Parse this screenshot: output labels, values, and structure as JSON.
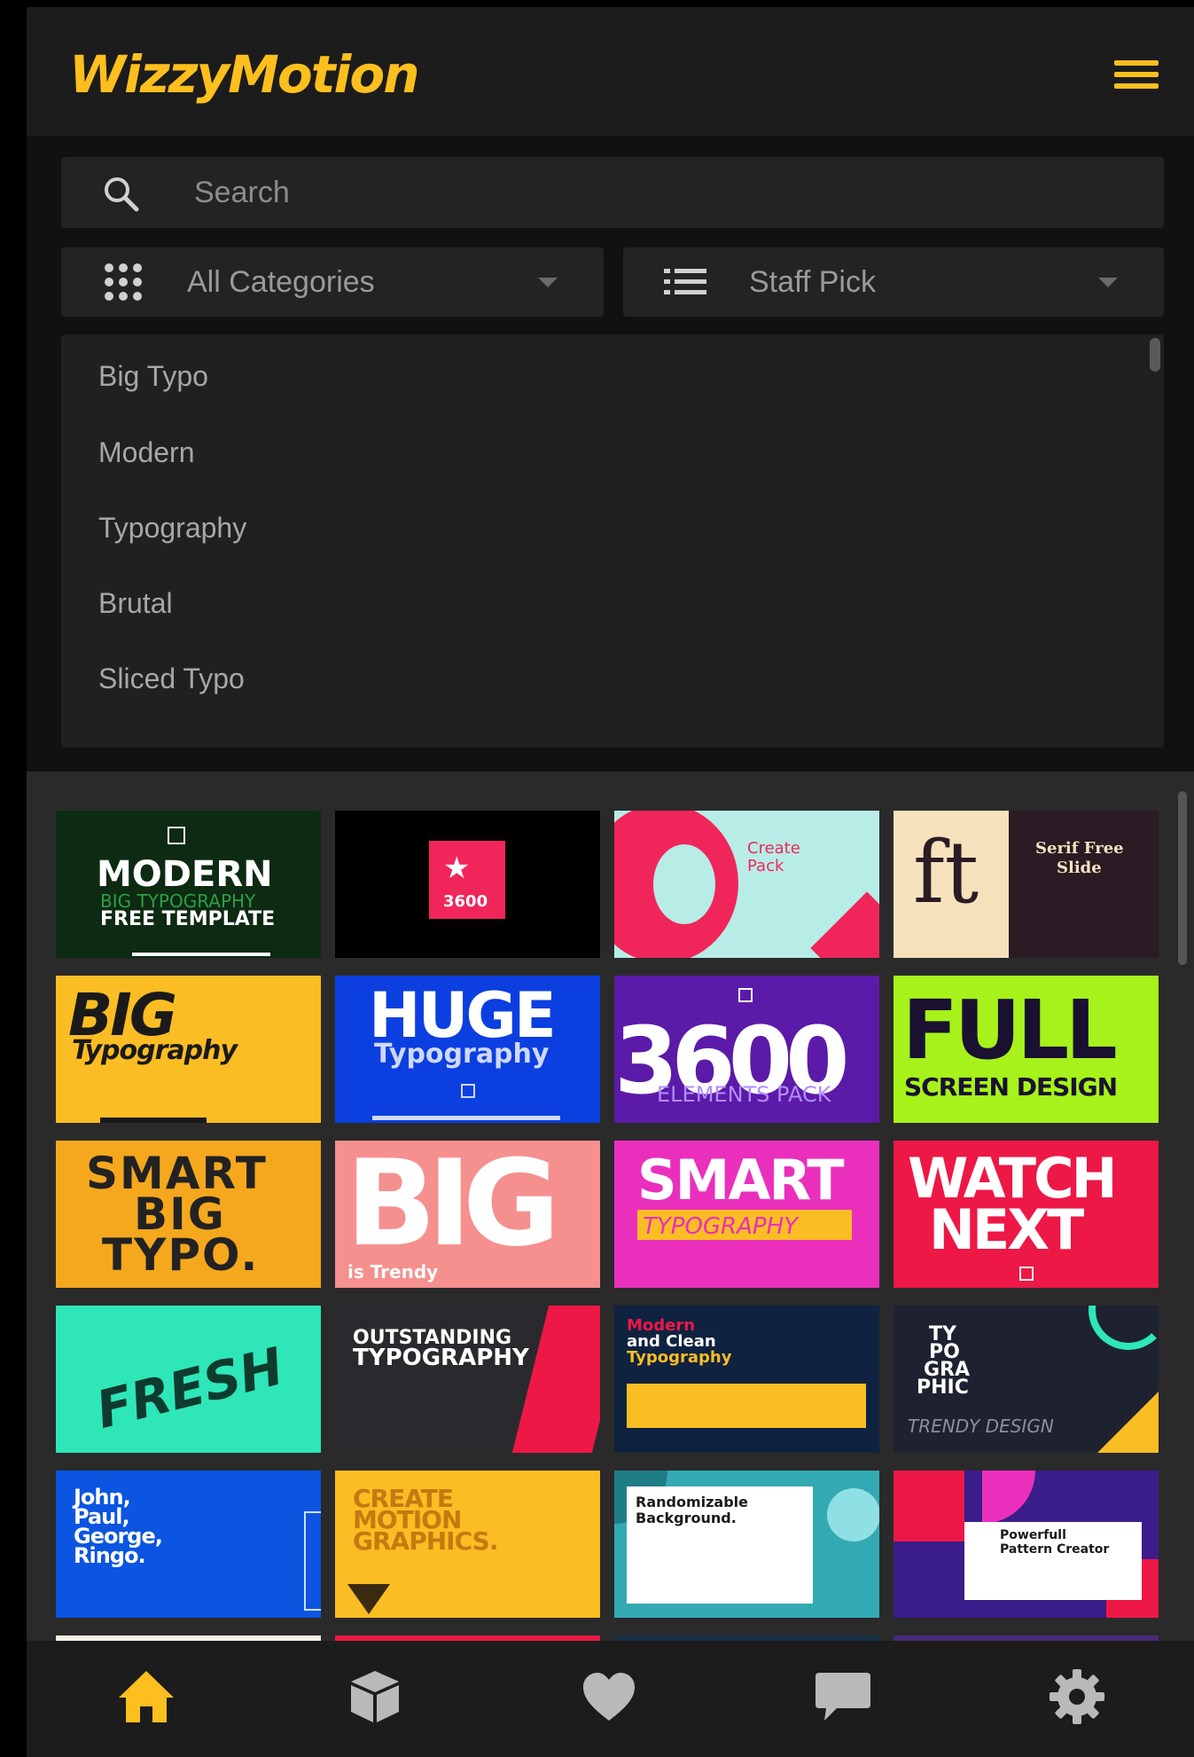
{
  "app": {
    "name": "WizzyMotion"
  },
  "colors": {
    "accent": "#fcbf1e",
    "icon_inactive": "#b9b9b9"
  },
  "search": {
    "placeholder": "Search",
    "value": ""
  },
  "filters": {
    "category": "All Categories",
    "sort": "Staff Pick"
  },
  "tags": [
    "Big Typo",
    "Modern",
    "Typography",
    "Brutal",
    "Sliced Typo"
  ],
  "cards": [
    {
      "lines": [
        "MODERN",
        "BIG TYPOGRAPHY",
        "FREE TEMPLATE"
      ]
    },
    {
      "lines": [
        "3600"
      ]
    },
    {
      "lines": [
        "Create",
        "Pack"
      ]
    },
    {
      "lines": [
        "ft",
        "Serif Free",
        "Slide"
      ]
    },
    {
      "lines": [
        "BIG",
        "Typography"
      ]
    },
    {
      "lines": [
        "HUGE",
        "Typography"
      ]
    },
    {
      "lines": [
        "3600",
        "ELEMENTS PACK"
      ]
    },
    {
      "lines": [
        "FULL",
        "SCREEN DESIGN"
      ]
    },
    {
      "lines": [
        "SMART",
        "BIG",
        "TYPO."
      ]
    },
    {
      "lines": [
        "BIG",
        "is Trendy"
      ]
    },
    {
      "lines": [
        "SMART",
        "TYPOGRAPHY"
      ]
    },
    {
      "lines": [
        "WATCH",
        "NEXT"
      ]
    },
    {
      "lines": [
        "FRESH"
      ]
    },
    {
      "lines": [
        "OUTSTANDING",
        "TYPOGRAPHY"
      ]
    },
    {
      "lines": [
        "Modern",
        "and Clean",
        "Typography"
      ]
    },
    {
      "lines": [
        "TY",
        "PO",
        "GRA",
        "PHIC",
        "TRENDY DESIGN"
      ]
    },
    {
      "lines": [
        "John,",
        "Paul,",
        "George,",
        "Ringo."
      ]
    },
    {
      "lines": [
        "CREATE",
        "MOTION",
        "GRAPHICS."
      ]
    },
    {
      "lines": [
        "Randomizable",
        "Background."
      ]
    },
    {
      "lines": [
        "Powerfull",
        "Pattern Creator"
      ]
    }
  ],
  "bottom_nav": [
    {
      "name": "home",
      "icon": "home-icon",
      "active": true
    },
    {
      "name": "packages",
      "icon": "cube-icon",
      "active": false
    },
    {
      "name": "favorites",
      "icon": "heart-icon",
      "active": false
    },
    {
      "name": "messages",
      "icon": "chat-icon",
      "active": false
    },
    {
      "name": "settings",
      "icon": "gear-icon",
      "active": false
    }
  ]
}
